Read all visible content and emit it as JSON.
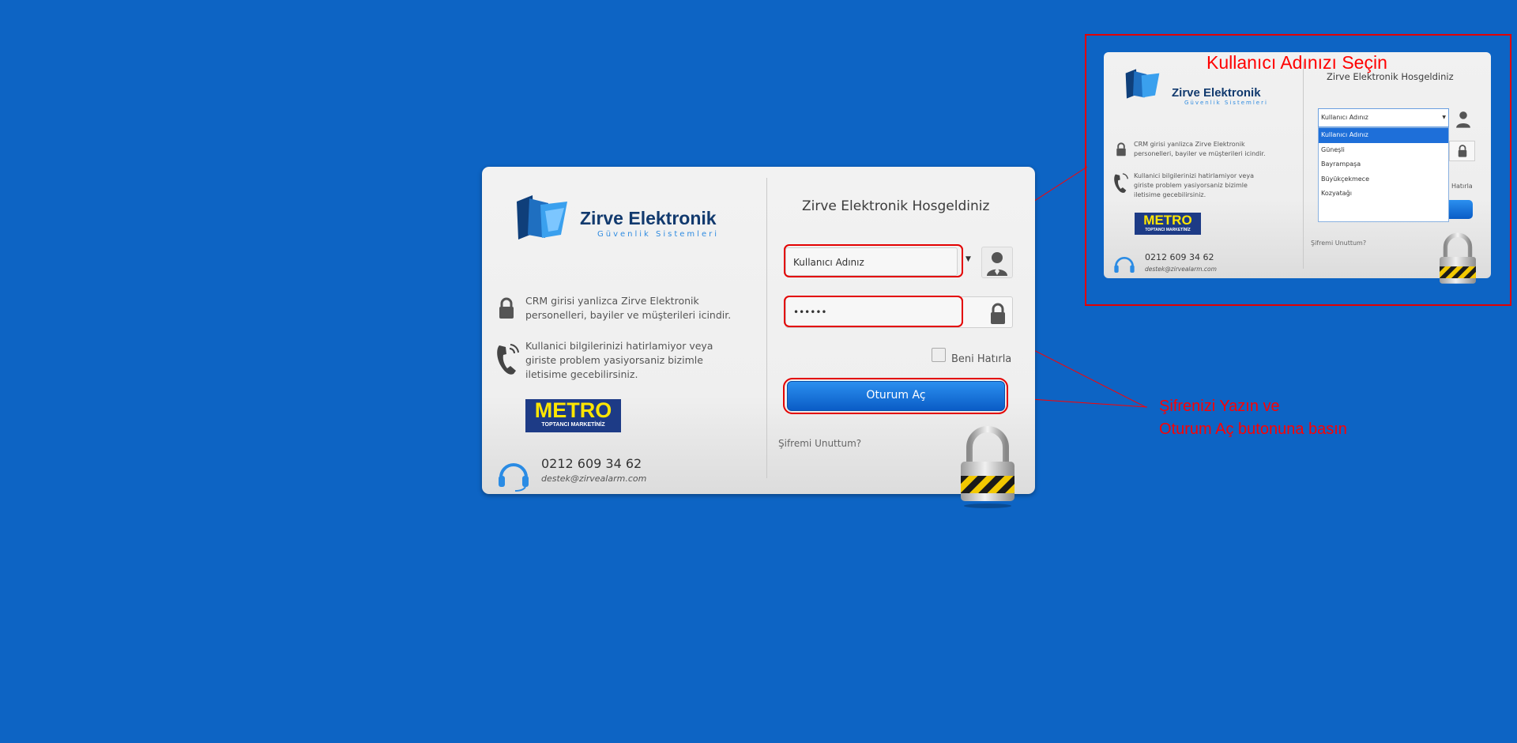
{
  "login": {
    "brand_name": "Zirve Elektronik",
    "brand_subtitle": "Güvenlik Sistemleri",
    "info_crm": "CRM girisi yanlizca Zirve Elektronik personelleri, bayiler ve müşterileri icindir.",
    "info_support": "Kullanici bilgilerinizi hatirlamiyor veya giriste problem yasiyorsaniz bizimle iletisime gecebilirsiniz.",
    "metro_title": "METRO",
    "metro_subtitle": "TOPTANCI MARKETİNİZ",
    "phone": "0212 609 34 62",
    "email": "destek@zirvealarm.com",
    "welcome": "Zirve Elektronik Hosgeldiniz",
    "username_value": "Kullanıcı Adınız",
    "password_value": "••••••",
    "remember_label": "Beni Hatırla",
    "login_button": "Oturum Aç",
    "forgot_password": "Şifremi Unuttum?"
  },
  "inset": {
    "title": "Kullanıcı Adınızı Seçin",
    "selected_value": "Kullanıcı Adınız",
    "options": [
      "Kullanıcı Adınız",
      "Güneşli",
      "Bayrampaşa",
      "Büyükçekmece",
      "Kozyatağı"
    ],
    "remember_partial": "Hatırla"
  },
  "annotations": {
    "line1": "Şifrenizi Yazın ve",
    "line2": "Oturum Aç butonuna basın"
  },
  "colors": {
    "background": "#0d64c4",
    "highlight": "#e30000",
    "button": "#1a74dd",
    "metro_yellow": "#ffe600"
  }
}
